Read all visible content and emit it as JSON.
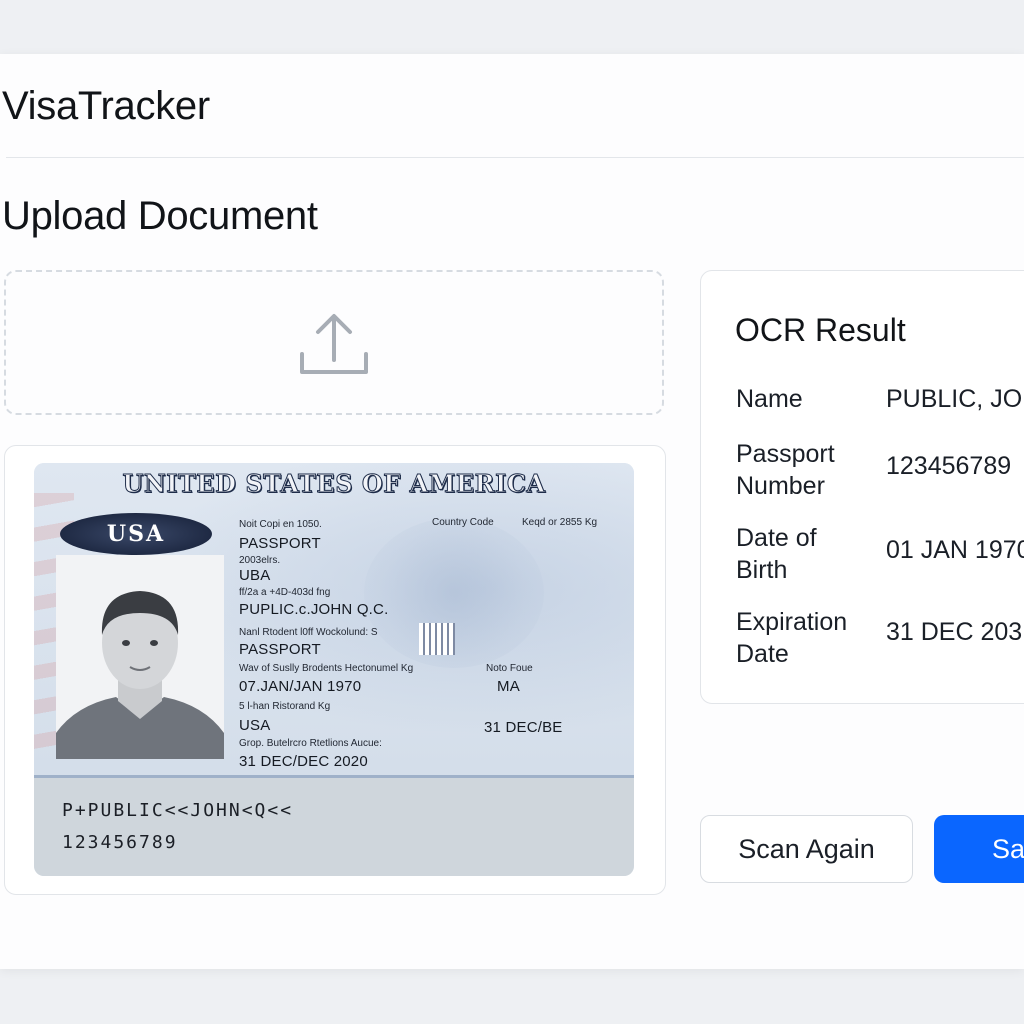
{
  "app": {
    "title": "VisaTracker"
  },
  "page": {
    "title": "Upload Document"
  },
  "upload": {
    "icon": "upload-icon"
  },
  "passport_image": {
    "header": "UNITED STATES OF AMERICA",
    "emblem": "USA",
    "fields": {
      "note_top": "Noit Copi en 1050.",
      "country_code_label": "Country Code",
      "kead_label": "Keqd or 2855 Kg",
      "type": "PASSPORT",
      "label_2": "2003elrs.",
      "code": "UBA",
      "label_3": "ff/2a a +4D-403d fng",
      "name": "PUPLIC.c.JOHN Q.C.",
      "label_4": "Nanl Rtodent l0ff Wockolund: S",
      "type_2": "PASSPORT",
      "label_5": "Wav of Suslly Brodents Hectonumel Kg",
      "label_5b": "Noto Foue",
      "dob": "07.JAN/JAN 1970",
      "sex": "MA",
      "label_6": "5 l-han Ristorand Kg",
      "nationality": "USA",
      "issue_partial": "31 DEC/BE",
      "label_7": "Grop. Butelrcro Rtetlions Aucue:",
      "expiry": "31 DEC/DEC 2020"
    },
    "mrz": [
      "P+PUBLIC<<JOHN<Q<<",
      "123456789"
    ]
  },
  "ocr": {
    "title": "OCR Result",
    "rows": [
      {
        "label": "Name",
        "value": "PUBLIC, JO"
      },
      {
        "label": "Passport Number",
        "value": "123456789"
      },
      {
        "label": "Date of Birth",
        "value": "01 JAN 1970"
      },
      {
        "label": "Expiration Date",
        "value": "31 DEC 203"
      }
    ]
  },
  "actions": {
    "scan_again": "Scan Again",
    "save": "Sa"
  },
  "colors": {
    "primary": "#0a66ff",
    "border": "#e2e5e9",
    "dashed": "#d6dbe1"
  }
}
